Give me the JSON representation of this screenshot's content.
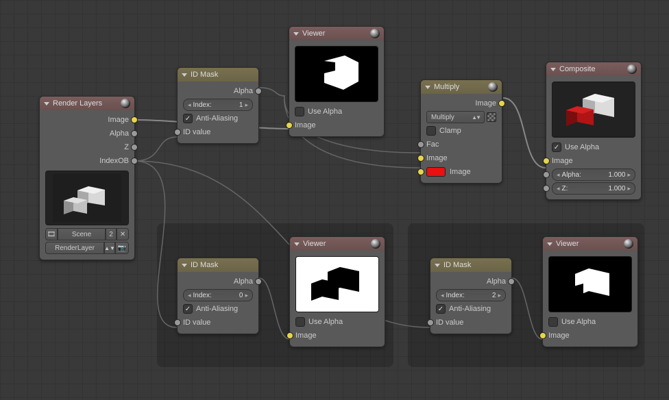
{
  "nodes": {
    "render_layers": {
      "title": "Render Layers",
      "outputs": [
        "Image",
        "Alpha",
        "Z",
        "IndexOB"
      ],
      "scene_label": "Scene",
      "scene_num": "2",
      "layer_label": "RenderLayer"
    },
    "id_mask_1": {
      "title": "ID Mask",
      "out_alpha": "Alpha",
      "index_label": "Index:",
      "index_value": "1",
      "anti_alias": "Anti-Aliasing",
      "in_id": "ID value"
    },
    "id_mask_0": {
      "title": "ID Mask",
      "out_alpha": "Alpha",
      "index_label": "Index:",
      "index_value": "0",
      "anti_alias": "Anti-Aliasing",
      "in_id": "ID value"
    },
    "id_mask_2": {
      "title": "ID Mask",
      "out_alpha": "Alpha",
      "index_label": "Index:",
      "index_value": "2",
      "anti_alias": "Anti-Aliasing",
      "in_id": "ID value"
    },
    "viewer_top": {
      "title": "Viewer",
      "use_alpha": "Use Alpha",
      "in_image": "Image"
    },
    "viewer_left": {
      "title": "Viewer",
      "use_alpha": "Use Alpha",
      "in_image": "Image"
    },
    "viewer_right": {
      "title": "Viewer",
      "use_alpha": "Use Alpha",
      "in_image": "Image"
    },
    "multiply": {
      "title": "Multiply",
      "out_image": "Image",
      "mode": "Multiply",
      "clamp": "Clamp",
      "in_fac": "Fac",
      "in_image1": "Image",
      "in_image2": "Image"
    },
    "composite": {
      "title": "Composite",
      "use_alpha": "Use Alpha",
      "in_image": "Image",
      "alpha_label": "Alpha:",
      "alpha_value": "1.000",
      "z_label": "Z:",
      "z_value": "1.000"
    }
  }
}
